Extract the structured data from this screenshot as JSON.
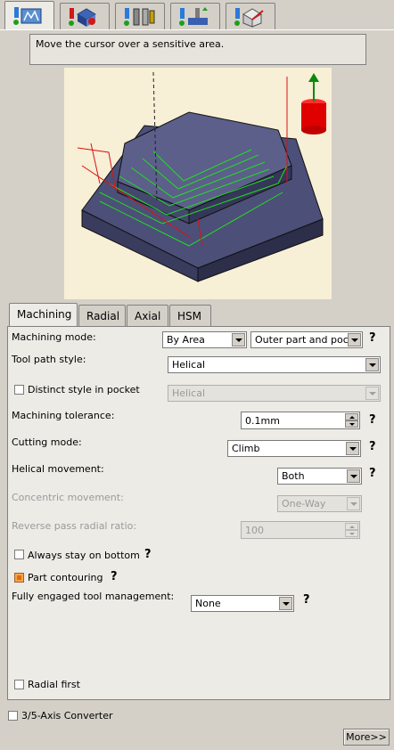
{
  "top_tabs": [
    {
      "name": "strategy-tab-icon",
      "active": true
    },
    {
      "name": "geometry-tab-icon",
      "active": false
    },
    {
      "name": "tool-tab-icon",
      "active": false
    },
    {
      "name": "feeds-speeds-tab-icon",
      "active": false
    },
    {
      "name": "macros-tab-icon",
      "active": false
    }
  ],
  "hint": "Move the cursor over a sensitive area.",
  "tabs": [
    "Machining",
    "Radial",
    "Axial",
    "HSM"
  ],
  "fields": {
    "machining_mode_label": "Machining mode:",
    "machining_mode_value": "By Area",
    "machining_mode_value2": "Outer part and pock",
    "tool_path_style_label": "Tool path style:",
    "tool_path_style_value": "Helical",
    "distinct_style_label": "Distinct style in pocket",
    "distinct_style_value": "Helical",
    "tolerance_label": "Machining tolerance:",
    "tolerance_value": "0.1mm",
    "cutting_mode_label": "Cutting mode:",
    "cutting_mode_value": "Climb",
    "helical_label": "Helical movement:",
    "helical_value": "Both",
    "concentric_label": "Concentric movement:",
    "concentric_value": "One-Way",
    "reverse_label": "Reverse pass radial ratio:",
    "reverse_value": "100",
    "always_bottom_label": "Always stay on bottom",
    "part_contouring_label": "Part contouring",
    "fully_engaged_label": "Fully engaged tool management:",
    "fully_engaged_value": "None",
    "radial_first_label": "Radial first"
  },
  "help_mark": "?",
  "converter_label": "3/5-Axis Converter",
  "more_button": "More>>"
}
